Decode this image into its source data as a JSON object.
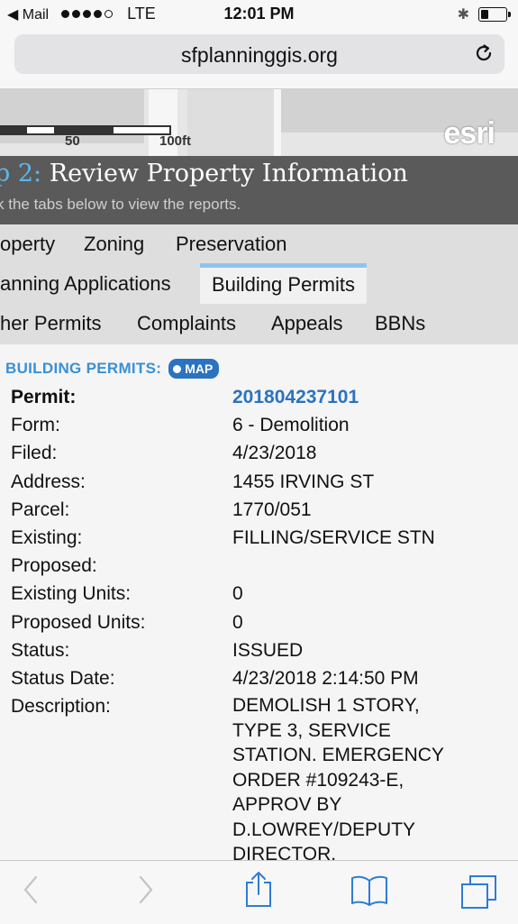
{
  "status_bar": {
    "back_app": "Mail",
    "carrier": "LTE",
    "time": "12:01 PM",
    "signal_bars": 4,
    "battery_level": 0.3
  },
  "browser": {
    "url": "sfplanninggis.org"
  },
  "map": {
    "scale_50": "50",
    "scale_100": "100ft",
    "logo": "esri"
  },
  "step": {
    "number": "p 2:",
    "title": "Review Property Information",
    "subtitle": "k the tabs below to view the reports."
  },
  "tabs": [
    {
      "label": "operty"
    },
    {
      "label": "Zoning"
    },
    {
      "label": "Preservation"
    },
    {
      "label": "anning Applications"
    },
    {
      "label": "Building Permits"
    },
    {
      "label": "her Permits"
    },
    {
      "label": "Complaints"
    },
    {
      "label": "Appeals"
    },
    {
      "label": "BBNs"
    }
  ],
  "building_permits": {
    "heading": "BUILDING PERMITS:",
    "map_button": "MAP",
    "rows": [
      {
        "label": "Permit:",
        "value": "201804237101"
      },
      {
        "label": "Form:",
        "value": "6 - Demolition"
      },
      {
        "label": "Filed:",
        "value": "4/23/2018"
      },
      {
        "label": "Address:",
        "value": "1455 IRVING ST"
      },
      {
        "label": "Parcel:",
        "value": "1770/051"
      },
      {
        "label": "Existing:",
        "value": "FILLING/SERVICE STN"
      },
      {
        "label": "Proposed:",
        "value": ""
      },
      {
        "label": "Existing Units:",
        "value": "0"
      },
      {
        "label": "Proposed Units:",
        "value": "0"
      },
      {
        "label": "Status:",
        "value": "ISSUED"
      },
      {
        "label": "Status Date:",
        "value": "4/23/2018 2:14:50 PM"
      },
      {
        "label": "Description:",
        "value": "DEMOLISH 1 STORY, TYPE 3, SERVICE STATION. EMERGENCY ORDER #109243-E, APPROV BY D.LOWREY/DEPUTY DIRECTOR."
      }
    ]
  },
  "toolbar": {
    "icons": [
      "back-icon",
      "forward-icon",
      "share-icon",
      "bookmarks-icon",
      "tabs-icon"
    ]
  },
  "colors": {
    "accent_blue": "#3a90d4",
    "link_blue": "#2a73c0",
    "tab_active_border": "#8ec5ef",
    "step_bg": "#5a5a5a",
    "ios_blue": "#2f7bd6"
  }
}
